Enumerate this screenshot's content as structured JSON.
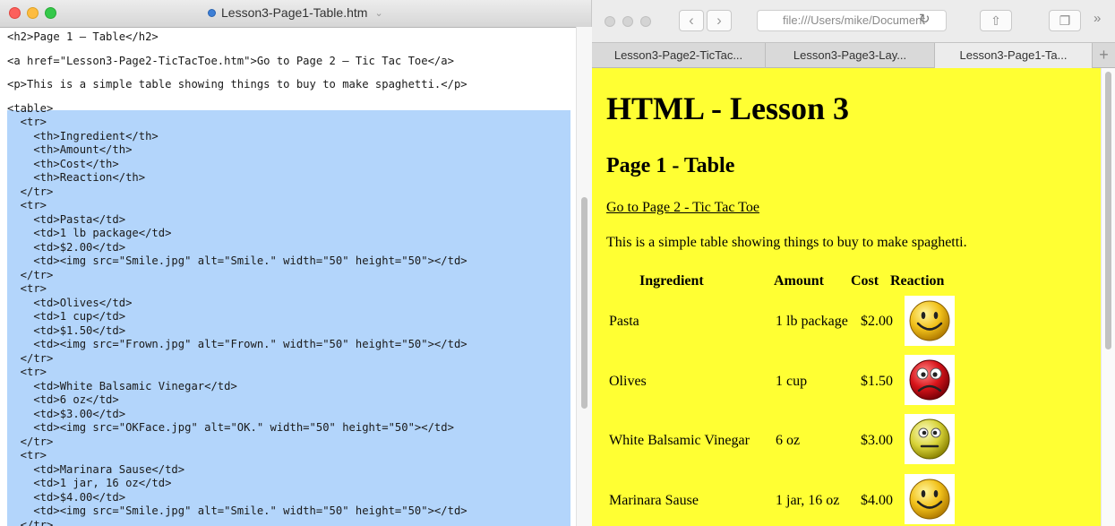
{
  "editor": {
    "title": "Lesson3-Page1-Table.htm",
    "lines": [
      "<h2>Page 1 – Table</h2>",
      "",
      "<a href=\"Lesson3-Page2-TicTacToe.htm\">Go to Page 2 – Tic Tac Toe</a>",
      "",
      "<p>This is a simple table showing things to buy to make spaghetti.</p>",
      "",
      "<table>",
      "  <tr>",
      "    <th>Ingredient</th>",
      "    <th>Amount</th>",
      "    <th>Cost</th>",
      "    <th>Reaction</th>",
      "  </tr>",
      "  <tr>",
      "    <td>Pasta</td>",
      "    <td>1 lb package</td>",
      "    <td>$2.00</td>",
      "    <td><img src=\"Smile.jpg\" alt=\"Smile.\" width=\"50\" height=\"50\"></td>",
      "  </tr>",
      "  <tr>",
      "    <td>Olives</td>",
      "    <td>1 cup</td>",
      "    <td>$1.50</td>",
      "    <td><img src=\"Frown.jpg\" alt=\"Frown.\" width=\"50\" height=\"50\"></td>",
      "  </tr>",
      "  <tr>",
      "    <td>White Balsamic Vinegar</td>",
      "    <td>6 oz</td>",
      "    <td>$3.00</td>",
      "    <td><img src=\"OKFace.jpg\" alt=\"OK.\" width=\"50\" height=\"50\"></td>",
      "  </tr>",
      "  <tr>",
      "    <td>Marinara Sause</td>",
      "    <td>1 jar, 16 oz</td>",
      "    <td>$4.00</td>",
      "    <td><img src=\"Smile.jpg\" alt=\"Smile.\" width=\"50\" height=\"50\"></td>",
      "  </tr>"
    ]
  },
  "browser": {
    "address": "file:///Users/mike/Document",
    "tabs": [
      "Lesson3-Page2-TicTac...",
      "Lesson3-Page3-Lay...",
      "Lesson3-Page1-Ta..."
    ],
    "active_tab": 2
  },
  "page": {
    "h1": "HTML - Lesson 3",
    "h2": "Page 1 - Table",
    "link": "Go to Page 2 - Tic Tac Toe",
    "paragraph": "This is a simple table showing things to buy to make spaghetti.",
    "table": {
      "headers": [
        "Ingredient",
        "Amount",
        "Cost",
        "Reaction"
      ],
      "rows": [
        {
          "ingredient": "Pasta",
          "amount": "1 lb package",
          "cost": "$2.00",
          "reaction": "smile-face-icon"
        },
        {
          "ingredient": "Olives",
          "amount": "1 cup",
          "cost": "$1.50",
          "reaction": "frown-face-icon"
        },
        {
          "ingredient": "White Balsamic Vinegar",
          "amount": "6 oz",
          "cost": "$3.00",
          "reaction": "ok-face-icon"
        },
        {
          "ingredient": "Marinara Sause",
          "amount": "1 jar, 16 oz",
          "cost": "$4.00",
          "reaction": "smile-face-icon"
        }
      ]
    }
  },
  "colors": {
    "page_background": "#ffff33",
    "selection": "#b3d5fb"
  }
}
